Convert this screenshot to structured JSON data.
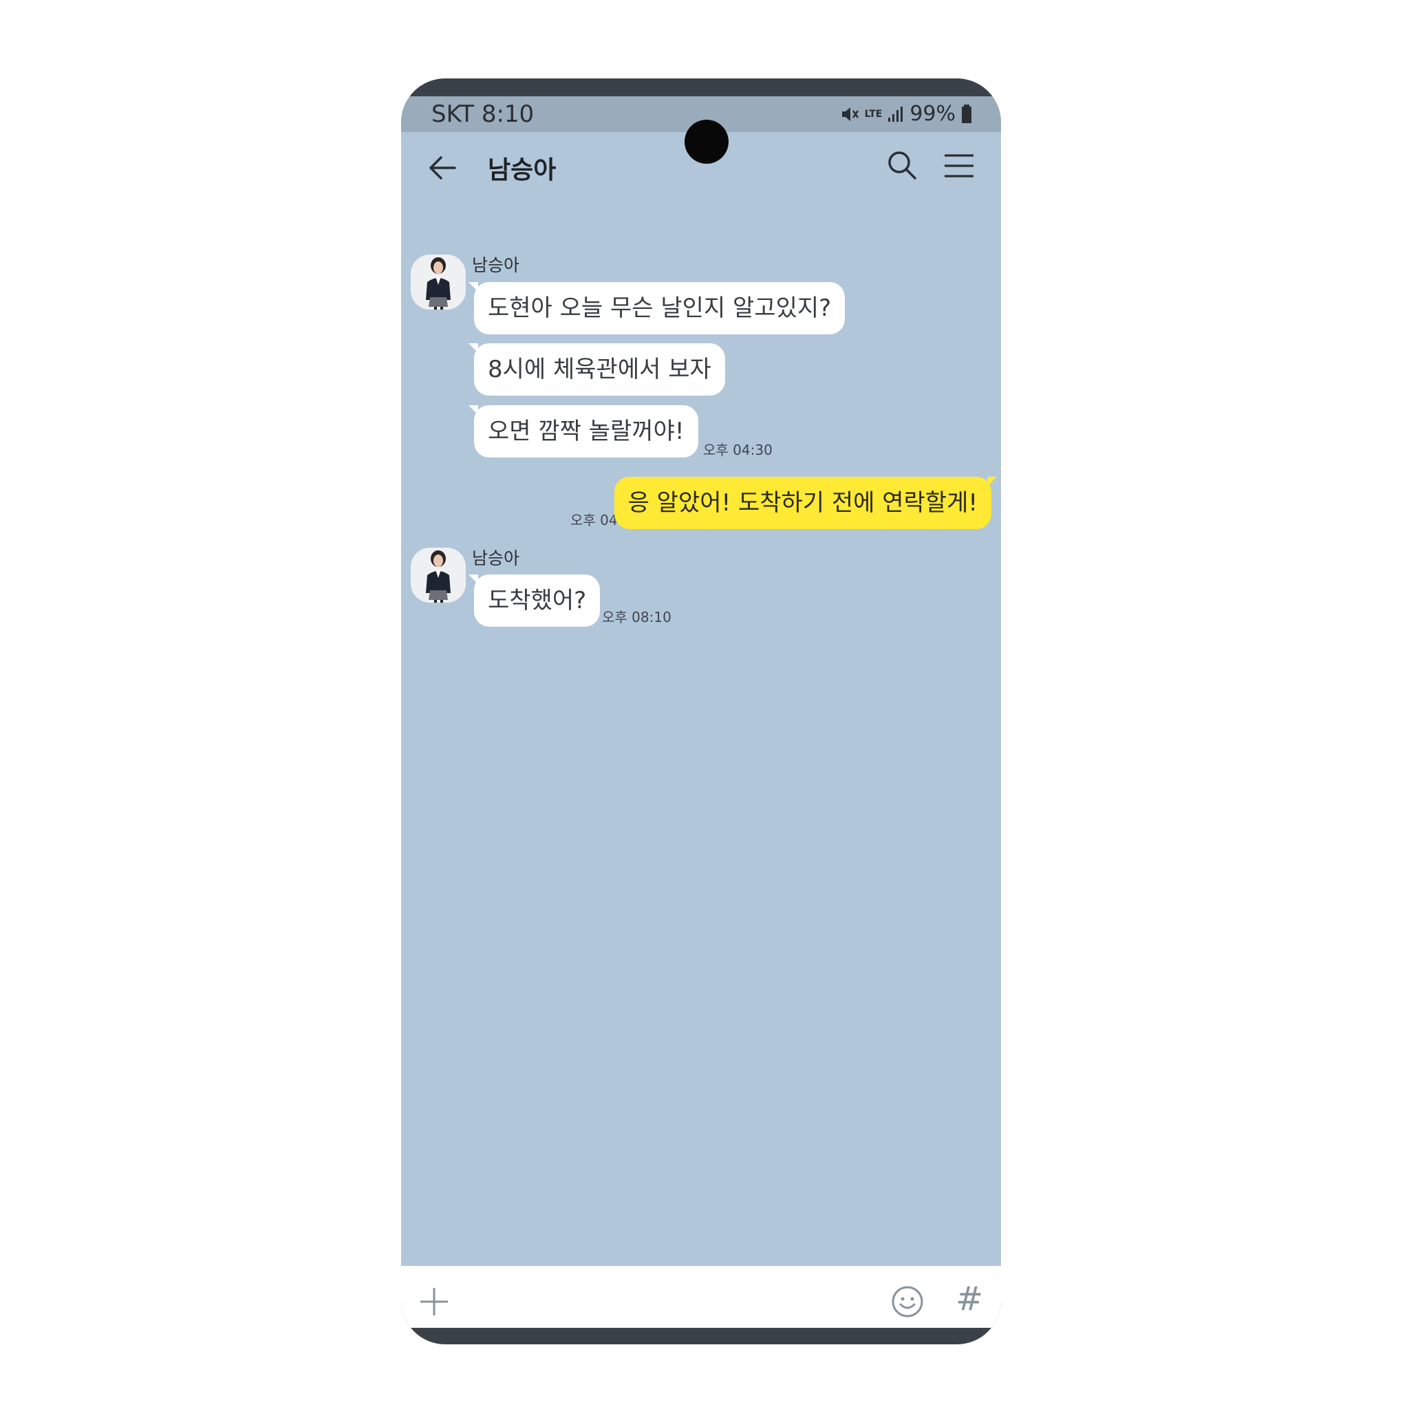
{
  "status_bar": {
    "carrier_time": "SKT 8:10",
    "network": "LTE",
    "battery": "99%"
  },
  "header": {
    "title": "남승아"
  },
  "messages": [
    {
      "sender": "남승아",
      "text": "도현아 오늘 무슨 날인지 알고있지?"
    },
    {
      "text": "8시에 체육관에서 보자"
    },
    {
      "text": "오면 깜짝 놀랄꺼야!",
      "time": "오후 04:30"
    },
    {
      "mine": true,
      "text": "응 알았어! 도착하기 전에 연락할게!",
      "time": "오후 04:32"
    },
    {
      "sender": "남승아",
      "text": "도착했어?",
      "time": "오후 08:10"
    }
  ],
  "icons": {
    "back": "arrow-left-icon",
    "search": "search-icon",
    "menu": "hamburger-menu-icon",
    "attach": "plus-icon",
    "emoji": "emoji-icon",
    "hashtag": "#",
    "nav_recent": "recent-apps-icon",
    "nav_home": "home-icon",
    "nav_back": "chevron-left-icon"
  },
  "colors": {
    "chat_background": "#b2c6da",
    "status_bar": "#9aabbb",
    "my_bubble": "#fee934",
    "their_bubble": "#ffffff"
  }
}
